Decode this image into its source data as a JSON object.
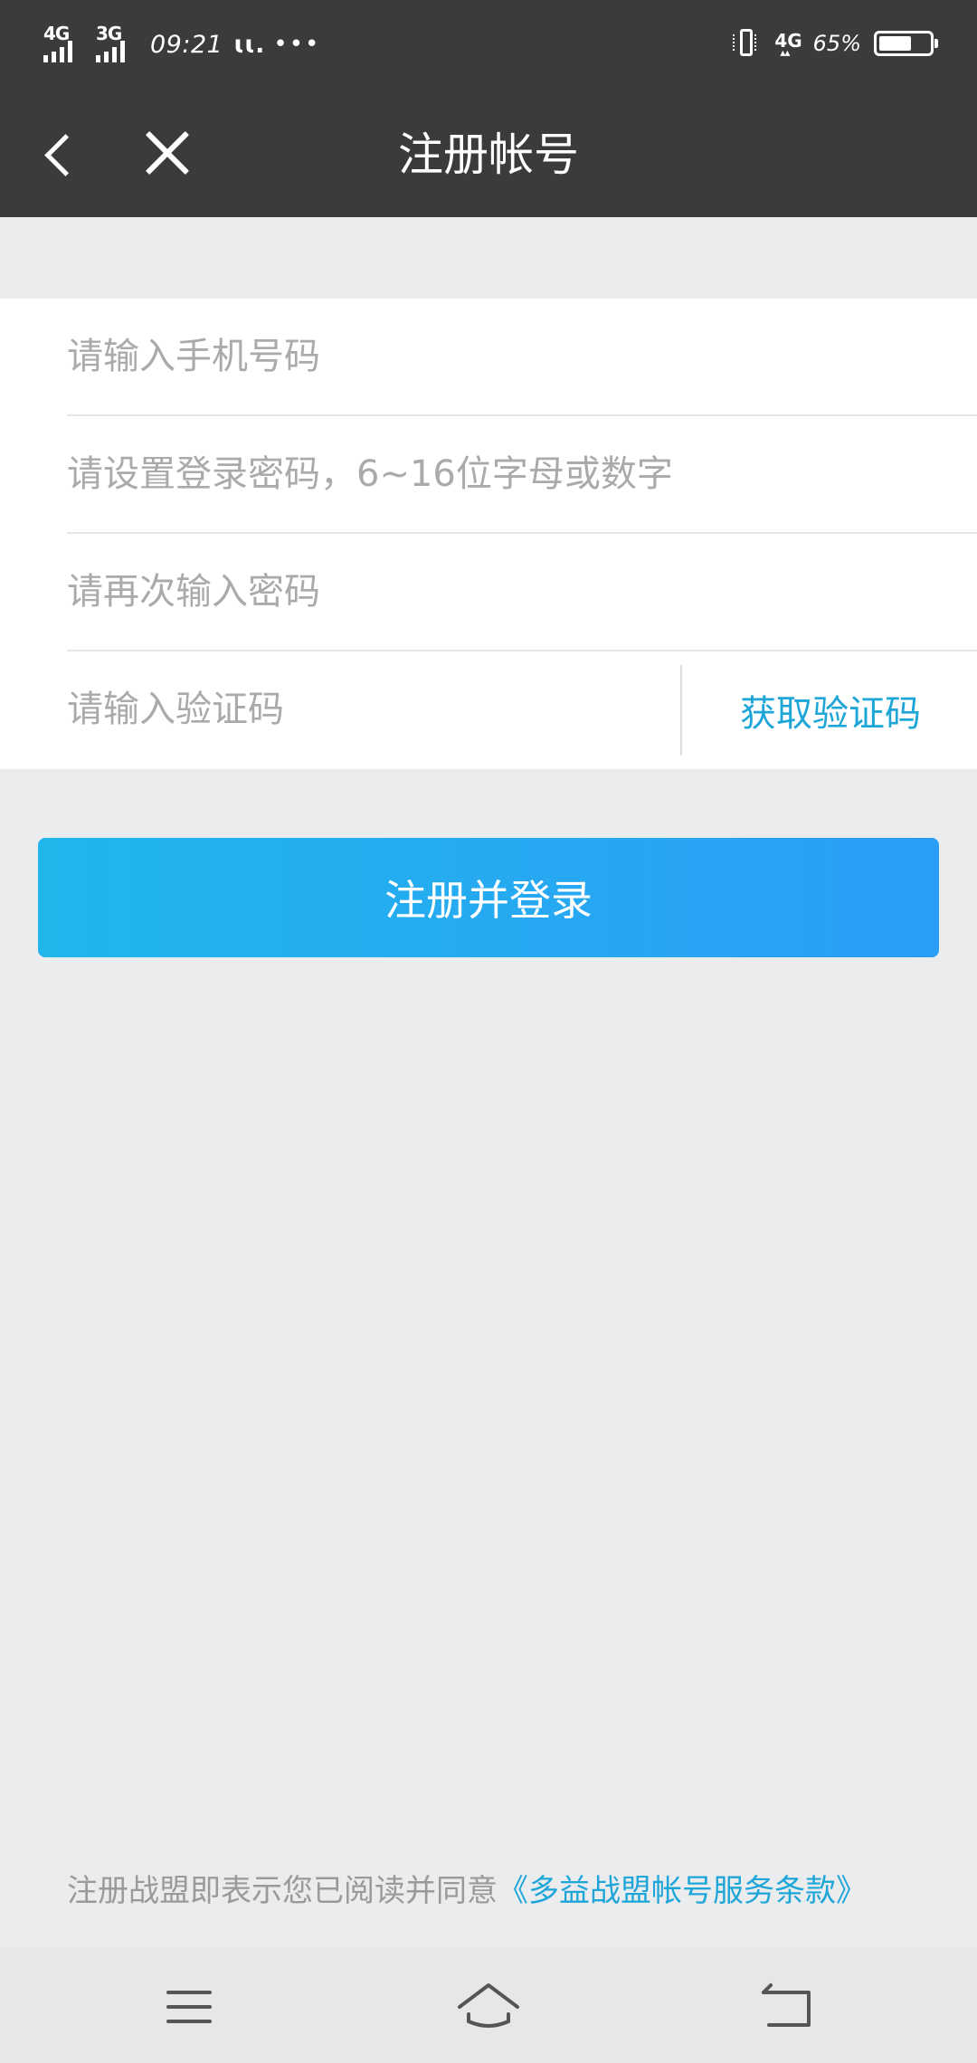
{
  "status_bar": {
    "network1": "4G",
    "network2": "3G",
    "time": "09:21",
    "carrier_glyph": "ɩɩ.",
    "more": "•••",
    "data_type": "4G",
    "battery_percent": "65%",
    "battery_level": 0.65
  },
  "header": {
    "title": "注册帐号",
    "back_icon": "chevron-left-icon",
    "close_icon": "close-icon"
  },
  "form": {
    "phone_placeholder": "请输入手机号码",
    "password_placeholder": "请设置登录密码，6~16位字母或数字",
    "confirm_password_placeholder": "请再次输入密码",
    "code_placeholder": "请输入验证码",
    "get_code_label": "获取验证码"
  },
  "register_button_label": "注册并登录",
  "agreement": {
    "text": "注册战盟即表示您已阅读并同意",
    "link": "《多益战盟帐号服务条款》"
  },
  "nav_bar": {
    "menu_icon": "menu-icon",
    "home_icon": "home-icon",
    "back_icon": "back-icon"
  },
  "colors": {
    "header_bg": "#3b3b3b",
    "page_bg": "#ebecee",
    "accent": "#1fa6d8",
    "button_gradient_start": "#20b6ec",
    "button_gradient_end": "#2a9ef6"
  }
}
